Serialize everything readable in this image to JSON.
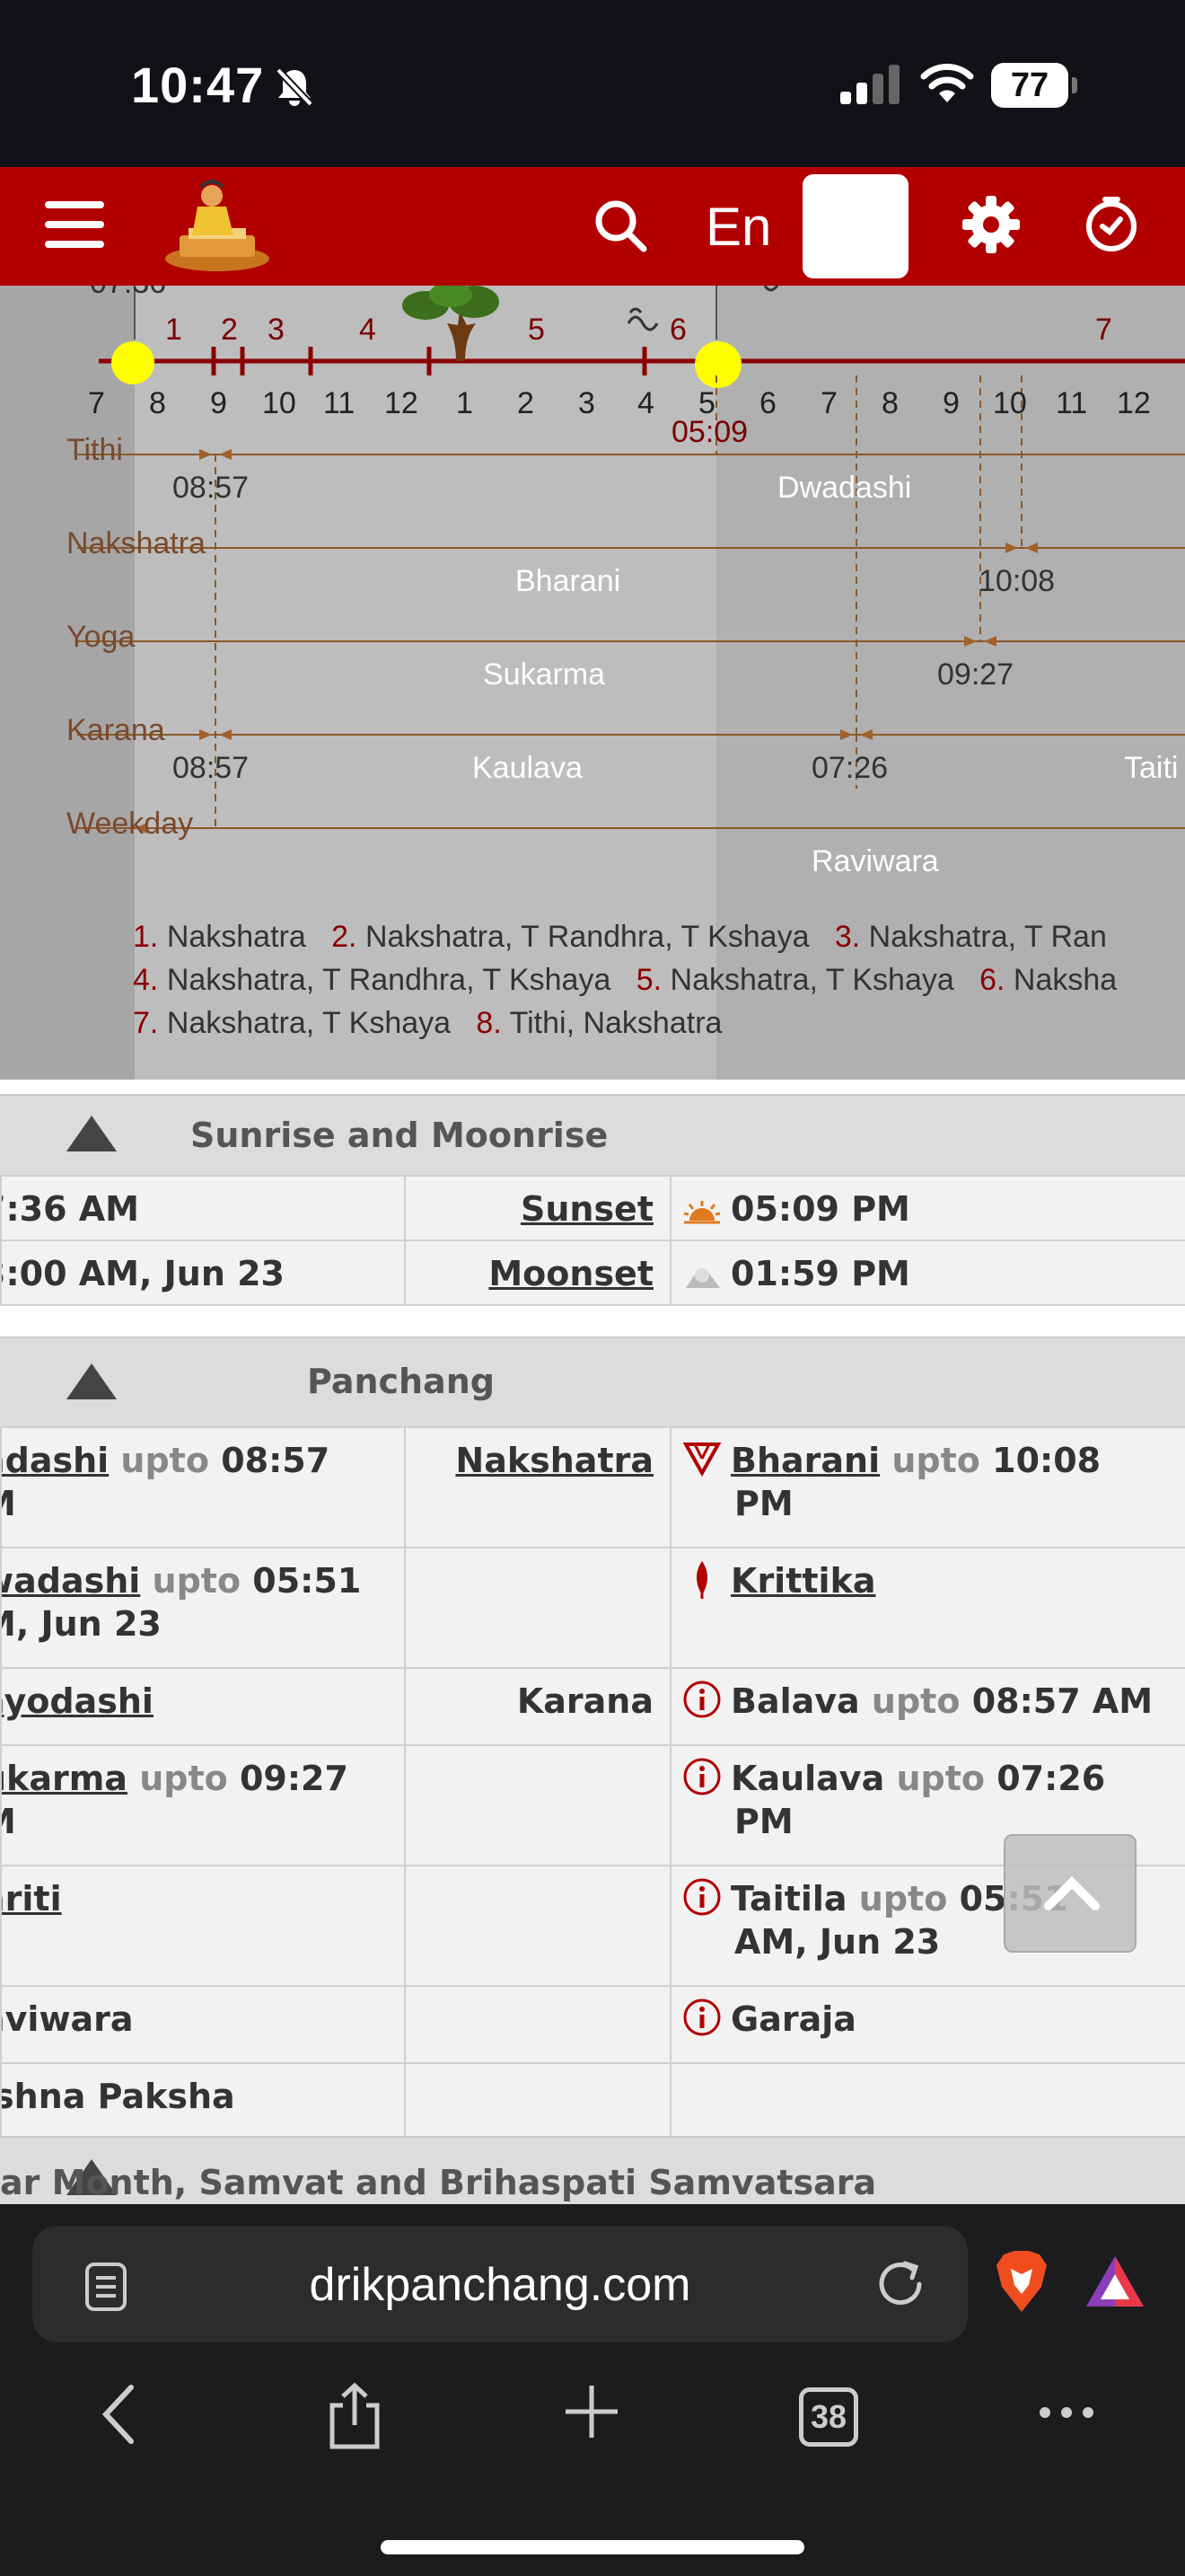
{
  "status_bar": {
    "time": "10:47",
    "battery": "77"
  },
  "header": {
    "lang": "En"
  },
  "timeline": {
    "sunrise_top": "07:36",
    "segments": [
      "1",
      "2",
      "3",
      "4",
      "5",
      "6",
      "7"
    ],
    "hours": [
      "7",
      "8",
      "9",
      "10",
      "11",
      "12",
      "1",
      "2",
      "3",
      "4",
      "5",
      "6",
      "7",
      "8",
      "9",
      "10",
      "11",
      "12"
    ],
    "sunset_time": "05:09",
    "rows": [
      {
        "label": "Tithi",
        "time": "08:57",
        "value": "Dwadashi"
      },
      {
        "label": "Nakshatra",
        "value": "Bharani",
        "time": "10:08"
      },
      {
        "label": "Yoga",
        "value": "Sukarma",
        "time": "09:27"
      },
      {
        "label": "Karana",
        "time": "08:57",
        "value": "Kaulava",
        "time2": "07:26",
        "value2": "Taiti"
      },
      {
        "label": "Weekday",
        "value": "Raviwara"
      }
    ],
    "legend": [
      [
        {
          "n": "1.",
          "t": "Nakshatra"
        },
        {
          "n": "2.",
          "t": "Nakshatra, T Randhra, T Kshaya"
        },
        {
          "n": "3.",
          "t": "Nakshatra, T Ran"
        }
      ],
      [
        {
          "n": "4.",
          "t": "Nakshatra, T Randhra, T Kshaya"
        },
        {
          "n": "5.",
          "t": "Nakshatra, T Kshaya"
        },
        {
          "n": "6.",
          "t": "Naksha"
        }
      ],
      [
        {
          "n": "7.",
          "t": "Nakshatra, T Kshaya"
        },
        {
          "n": "8.",
          "t": "Tithi, Nakshatra"
        }
      ]
    ]
  },
  "sunrise_section": {
    "title": "Sunrise and Moonrise",
    "rows": [
      {
        "c1": "7:36 AM",
        "label": "Sunset",
        "value": "05:09 PM"
      },
      {
        "c1": "3:00 AM, Jun 23",
        "label": "Moonset",
        "value": "01:59 PM"
      }
    ]
  },
  "panchang_section": {
    "title": "Panchang",
    "rows": [
      {
        "c1_link": "adashi",
        "c1_upto": "upto",
        "c1_time": "08:57",
        "c1_line2": "M",
        "label": "Nakshatra",
        "c3_link": "Bharani",
        "c3_upto": "upto",
        "c3_time": "10:08",
        "c3_line2": "PM"
      },
      {
        "c1_link": "wadashi",
        "c1_upto": "upto",
        "c1_time": "05:51",
        "c1_line2": "M, Jun 23",
        "label": "",
        "c3_link": "Krittika"
      },
      {
        "c1_link": "ayodashi",
        "label": "Karana",
        "c3_name": "Balava",
        "c3_upto": "upto",
        "c3_time": "08:57 AM"
      },
      {
        "c1_link": "ukarma",
        "c1_upto": "upto",
        "c1_time": "09:27",
        "c1_line2": "M",
        "label": "",
        "c3_name": "Kaulava",
        "c3_upto": "upto",
        "c3_time": "07:26",
        "c3_line2": "PM"
      },
      {
        "c1_link": "ariti",
        "label": "",
        "c3_name": "Taitila",
        "c3_upto": "upto",
        "c3_time": "05:51",
        "c3_line2": "AM, Jun 23"
      },
      {
        "c1_text": "aviwara",
        "label": "",
        "c3_name": "Garaja"
      },
      {
        "c1_text": "ishna Paksha",
        "label": "",
        "c3_name": ""
      }
    ]
  },
  "next_section": {
    "title": "ar Month, Samvat and Brihaspati Samvatsara"
  },
  "browser": {
    "url": "drikpanchang.com",
    "tab_count": "38"
  },
  "colors": {
    "header_red": "#b20000",
    "accent_dark_red": "#8b0000",
    "label_brown": "#7a4a2b"
  }
}
